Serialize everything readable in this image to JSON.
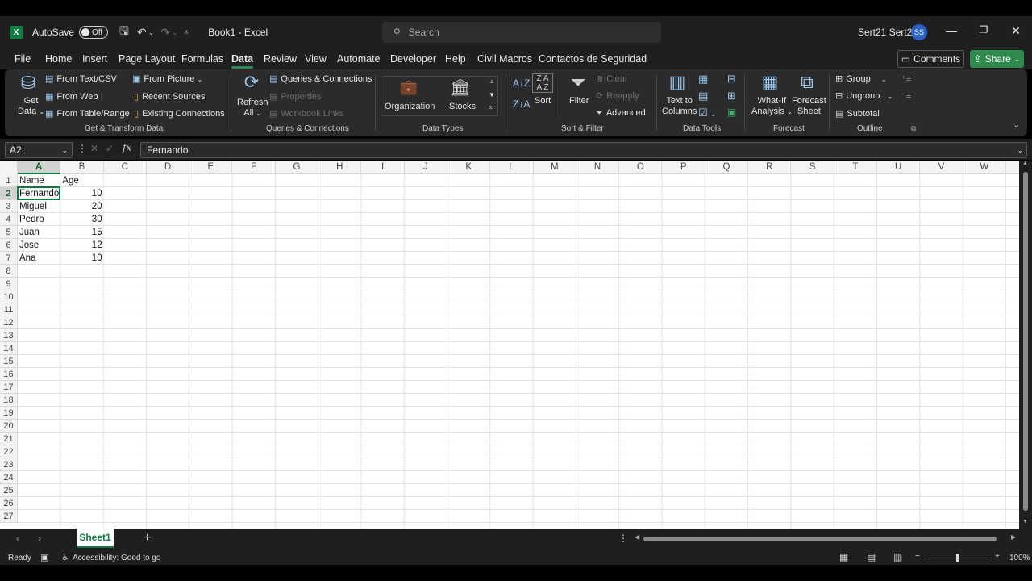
{
  "titlebar": {
    "autosave_label": "AutoSave",
    "toggle_state": "Off",
    "doc_title": "Book1  -  Excel",
    "search_placeholder": "Search",
    "user_name": "Sert21 Sert21",
    "avatar_initials": "SS"
  },
  "menu": {
    "tabs": [
      "File",
      "Home",
      "Insert",
      "Page Layout",
      "Formulas",
      "Data",
      "Review",
      "View",
      "Automate",
      "Developer",
      "Help",
      "Civil Macros",
      "Contactos de Seguridad"
    ],
    "active_tab": "Data",
    "comments_label": "Comments",
    "share_label": "Share"
  },
  "ribbon": {
    "get_transform": {
      "get_data": [
        "Get",
        "Data"
      ],
      "from_text_csv": "From Text/CSV",
      "from_web": "From Web",
      "from_table_range": "From Table/Range",
      "from_picture": "From Picture",
      "recent_sources": "Recent Sources",
      "existing_connections": "Existing Connections",
      "label": "Get & Transform Data"
    },
    "queries": {
      "refresh": [
        "Refresh",
        "All"
      ],
      "queries_connections": "Queries & Connections",
      "properties": "Properties",
      "workbook_links": "Workbook Links",
      "label": "Queries & Connections"
    },
    "data_types": {
      "organization": "Organization",
      "stocks": "Stocks",
      "label": "Data Types"
    },
    "sort_filter": {
      "sort": "Sort",
      "filter": "Filter",
      "clear": "Clear",
      "reapply": "Reapply",
      "advanced": "Advanced",
      "label": "Sort & Filter"
    },
    "data_tools": {
      "text_to_columns": [
        "Text to",
        "Columns"
      ],
      "label": "Data Tools"
    },
    "forecast": {
      "what_if": [
        "What-If",
        "Analysis"
      ],
      "forecast_sheet": [
        "Forecast",
        "Sheet"
      ],
      "label": "Forecast"
    },
    "outline": {
      "group": "Group",
      "ungroup": "Ungroup",
      "subtotal": "Subtotal",
      "label": "Outline"
    }
  },
  "formula_bar": {
    "name_box": "A2",
    "content": "Fernando"
  },
  "grid": {
    "columns": [
      "A",
      "B",
      "C",
      "D",
      "E",
      "F",
      "G",
      "H",
      "I",
      "J",
      "K",
      "L",
      "M",
      "N",
      "O",
      "P",
      "Q",
      "R",
      "S",
      "T",
      "U",
      "V",
      "W"
    ],
    "rows": [
      "1",
      "2",
      "3",
      "4",
      "5",
      "6",
      "7",
      "8",
      "9",
      "10",
      "11",
      "12",
      "13",
      "14",
      "15",
      "16",
      "17",
      "18",
      "19",
      "20",
      "21",
      "22",
      "23",
      "24",
      "25",
      "26",
      "27"
    ],
    "selected_column": "A",
    "selected_row": "2",
    "data": [
      [
        "Name",
        "Age"
      ],
      [
        "Fernando",
        "10"
      ],
      [
        "Miguel",
        "20"
      ],
      [
        "Pedro",
        "30"
      ],
      [
        "Juan",
        "15"
      ],
      [
        "Jose",
        "12"
      ],
      [
        "Ana",
        "10"
      ]
    ]
  },
  "sheets": {
    "active": "Sheet1"
  },
  "status": {
    "ready": "Ready",
    "accessibility": "Accessibility: Good to go",
    "zoom": "100%"
  }
}
